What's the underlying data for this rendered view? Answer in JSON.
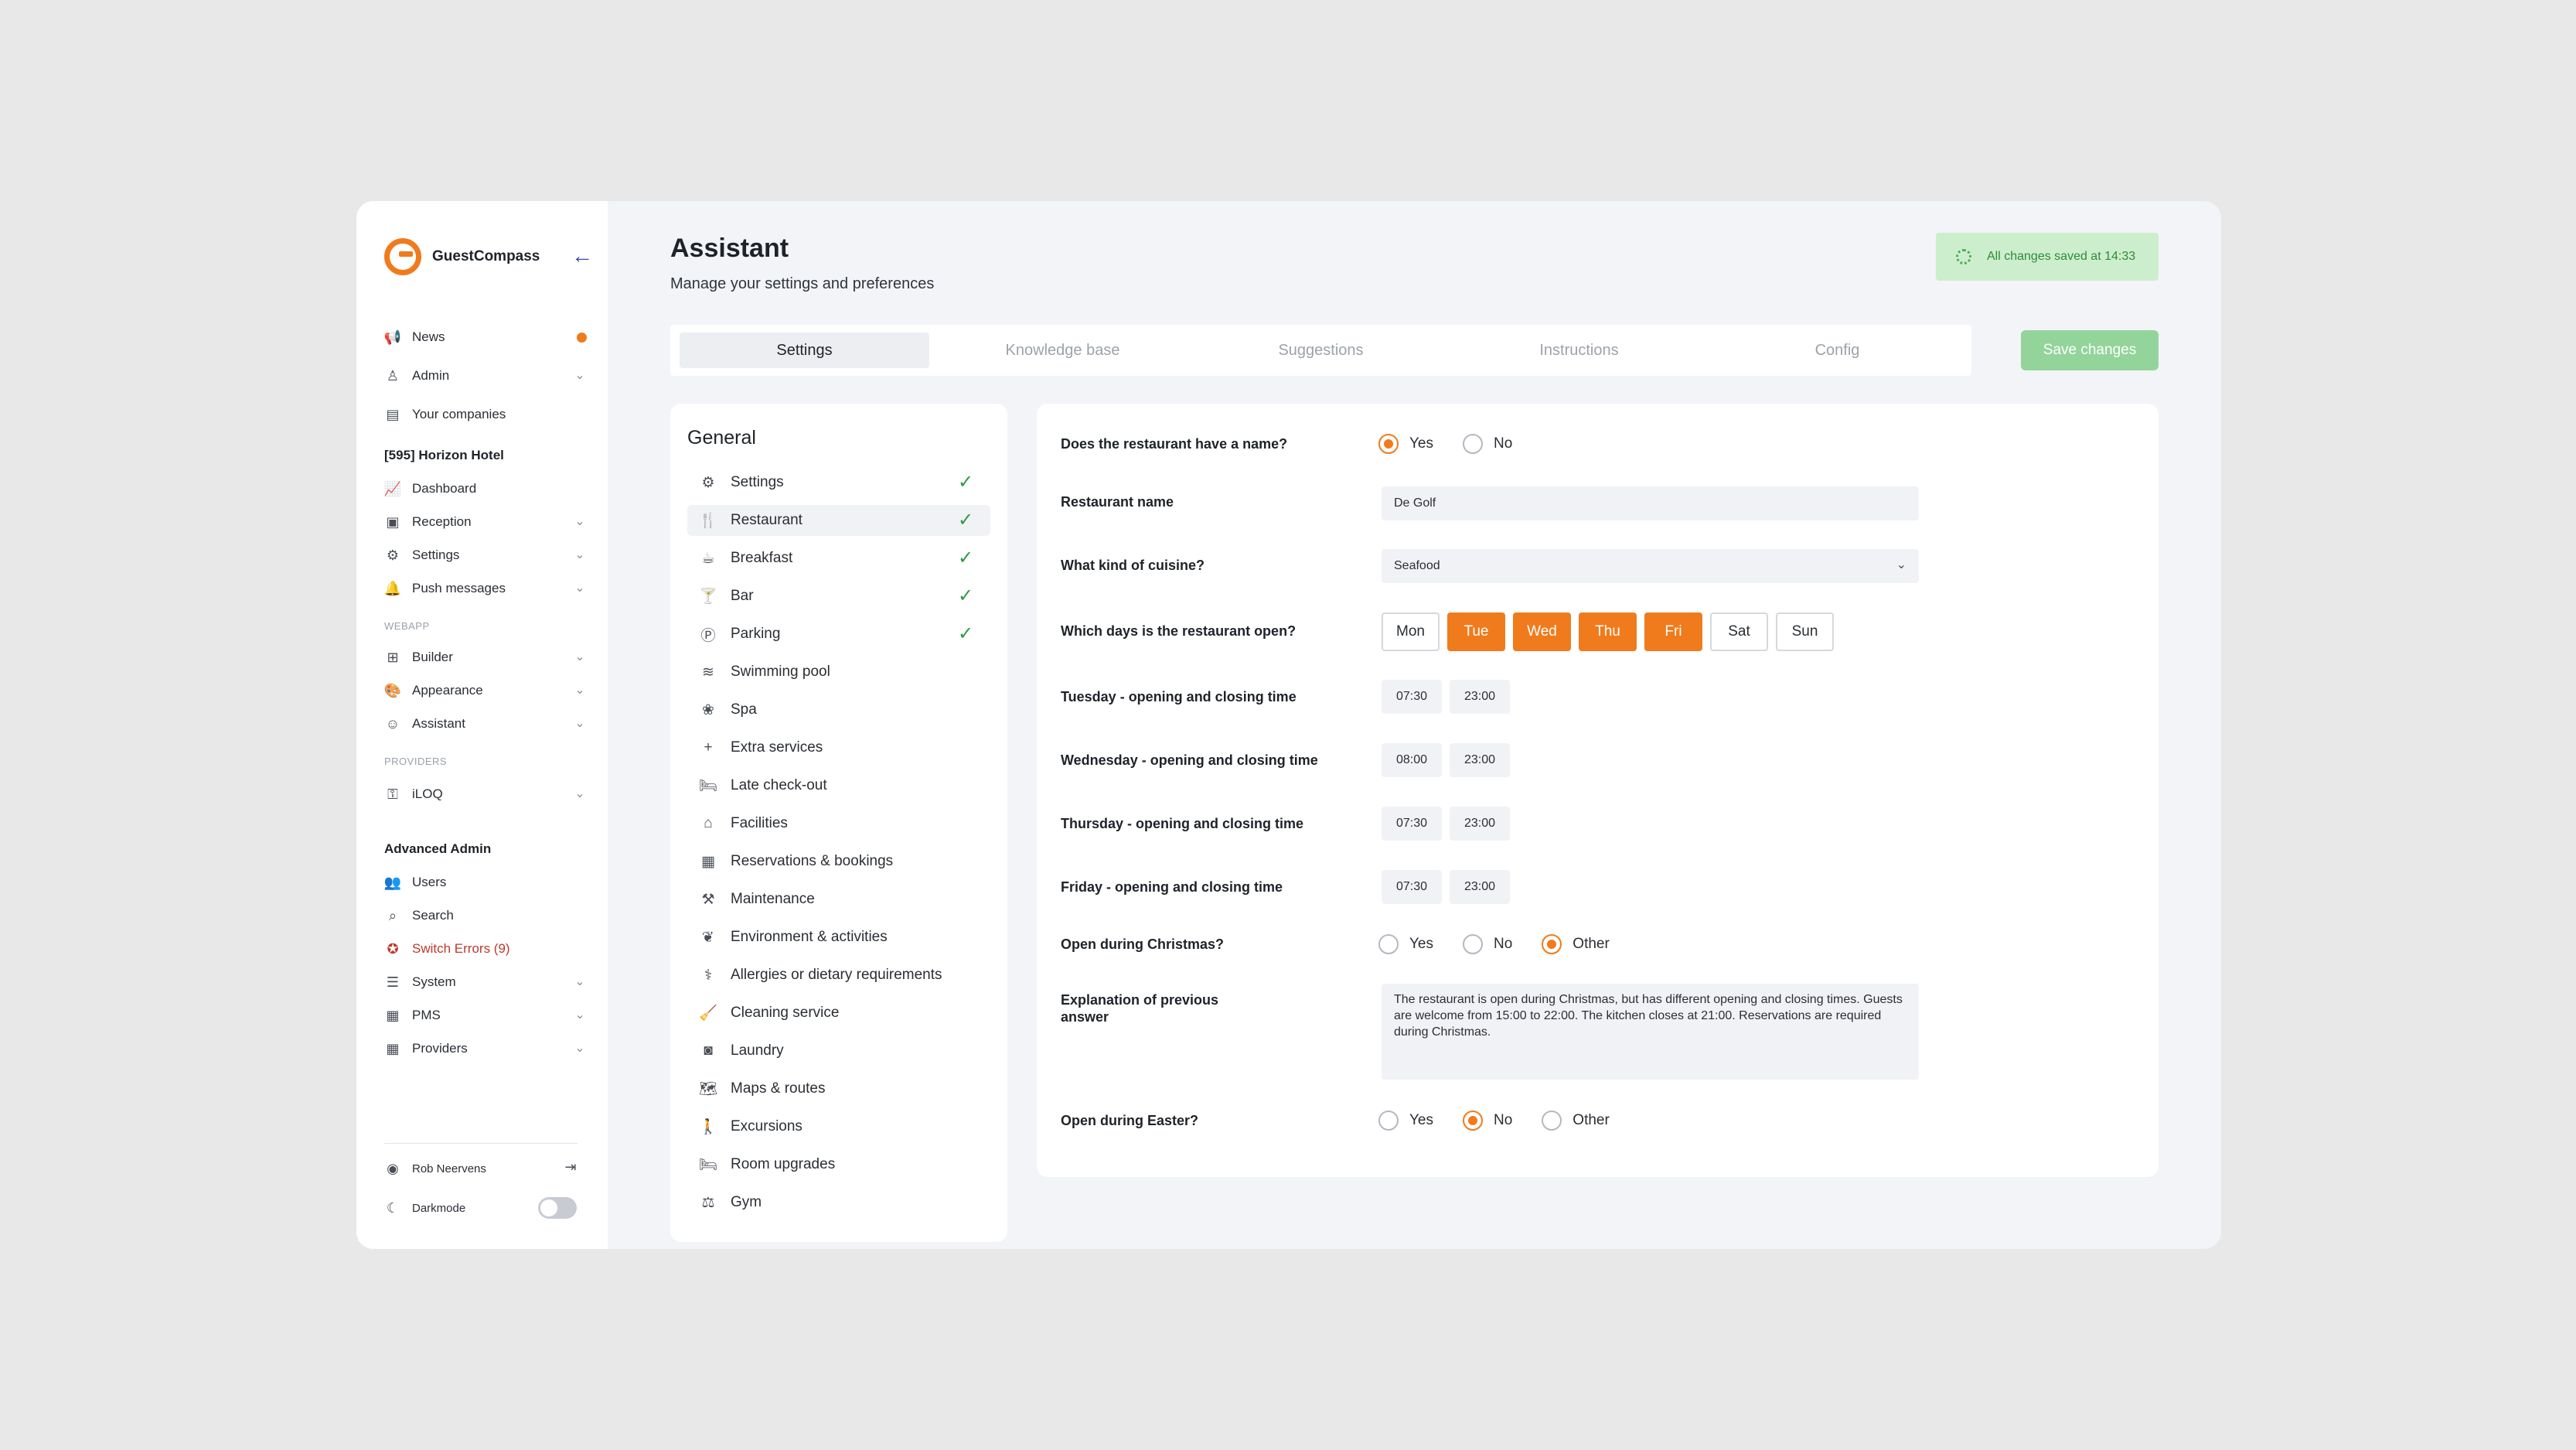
{
  "app": {
    "brand": "GuestCompass"
  },
  "sidebar": {
    "top_items": [
      {
        "label": "News",
        "icon": "megaphone-icon"
      },
      {
        "label": "Admin",
        "icon": "user-icon"
      },
      {
        "label": "Your companies",
        "icon": "building-icon"
      }
    ],
    "hotel_title": "[595] Horizon Hotel",
    "hotel_items": [
      {
        "label": "Dashboard",
        "icon": "chart-icon"
      },
      {
        "label": "Reception",
        "icon": "reception-icon"
      },
      {
        "label": "Settings",
        "icon": "gear-icon"
      },
      {
        "label": "Push messages",
        "icon": "bell-icon"
      }
    ],
    "webapp_label": "WEBAPP",
    "webapp_items": [
      {
        "label": "Builder",
        "icon": "builder-icon"
      },
      {
        "label": "Appearance",
        "icon": "palette-icon"
      },
      {
        "label": "Assistant",
        "icon": "bot-icon"
      }
    ],
    "providers_label": "PROVIDERS",
    "provider_items": [
      {
        "label": "iLOQ",
        "icon": "key-icon"
      }
    ],
    "advanced_title": "Advanced Admin",
    "advanced_items": [
      {
        "label": "Users",
        "icon": "users-icon"
      },
      {
        "label": "Search",
        "icon": "search-icon"
      },
      {
        "label": "Switch Errors (9)",
        "icon": "bug-icon"
      },
      {
        "label": "System",
        "icon": "database-icon"
      },
      {
        "label": "PMS",
        "icon": "calendar-icon"
      },
      {
        "label": "Providers",
        "icon": "calendar-icon"
      }
    ],
    "user_name": "Rob Neervens",
    "darkmode_label": "Darkmode",
    "darkmode_on": false
  },
  "header": {
    "title": "Assistant",
    "subtitle": "Manage your settings and preferences",
    "saved_status": "All changes saved at 14:33",
    "save_button": "Save changes"
  },
  "tabs": [
    "Settings",
    "Knowledge base",
    "Suggestions",
    "Instructions",
    "Config"
  ],
  "general": {
    "title": "General",
    "items": [
      {
        "label": "Settings",
        "icon": "gear-icon",
        "done": true
      },
      {
        "label": "Restaurant",
        "icon": "utensils-icon",
        "done": true
      },
      {
        "label": "Breakfast",
        "icon": "coffee-icon",
        "done": true
      },
      {
        "label": "Bar",
        "icon": "cocktail-icon",
        "done": true
      },
      {
        "label": "Parking",
        "icon": "parking-icon",
        "done": true
      },
      {
        "label": "Swimming pool",
        "icon": "pool-icon",
        "done": false
      },
      {
        "label": "Spa",
        "icon": "lotus-icon",
        "done": false
      },
      {
        "label": "Extra services",
        "icon": "plus-icon",
        "done": false
      },
      {
        "label": "Late check-out",
        "icon": "bed-icon",
        "done": false
      },
      {
        "label": "Facilities",
        "icon": "facilities-icon",
        "done": false
      },
      {
        "label": "Reservations & bookings",
        "icon": "calendar-icon",
        "done": false
      },
      {
        "label": "Maintenance",
        "icon": "hammer-icon",
        "done": false
      },
      {
        "label": "Environment & activities",
        "icon": "leaf-icon",
        "done": false
      },
      {
        "label": "Allergies or dietary requirements",
        "icon": "allergy-icon",
        "done": false
      },
      {
        "label": "Cleaning service",
        "icon": "broom-icon",
        "done": false
      },
      {
        "label": "Laundry",
        "icon": "washer-icon",
        "done": false
      },
      {
        "label": "Maps & routes",
        "icon": "map-icon",
        "done": false
      },
      {
        "label": "Excursions",
        "icon": "hiking-icon",
        "done": false
      },
      {
        "label": "Room upgrades",
        "icon": "bed-icon",
        "done": false
      },
      {
        "label": "Gym",
        "icon": "dumbbell-icon",
        "done": false
      }
    ]
  },
  "form": {
    "q_name": "Does the restaurant have a name?",
    "opt_yes": "Yes",
    "opt_no": "No",
    "opt_other": "Other",
    "q_restaurant_name": "Restaurant name",
    "restaurant_name_value": "De Golf",
    "q_cuisine": "What kind of cuisine?",
    "cuisine_value": "Seafood",
    "q_days": "Which days is the restaurant open?",
    "days": [
      {
        "label": "Mon",
        "open": false
      },
      {
        "label": "Tue",
        "open": true
      },
      {
        "label": "Wed",
        "open": true
      },
      {
        "label": "Thu",
        "open": true
      },
      {
        "label": "Fri",
        "open": true
      },
      {
        "label": "Sat",
        "open": false
      },
      {
        "label": "Sun",
        "open": false
      }
    ],
    "hours": [
      {
        "label": "Tuesday - opening and closing time",
        "open": "07:30",
        "close": "23:00"
      },
      {
        "label": "Wednesday - opening and closing time",
        "open": "08:00",
        "close": "23:00"
      },
      {
        "label": "Thursday - opening and closing time",
        "open": "07:30",
        "close": "23:00"
      },
      {
        "label": "Friday - opening and closing time",
        "open": "07:30",
        "close": "23:00"
      }
    ],
    "q_christmas": "Open during Christmas?",
    "christmas_selected": "Other",
    "q_explanation": "Explanation of previous answer",
    "explanation_value": "The restaurant is open during Christmas, but has different opening and closing times. Guests are welcome from 15:00 to 22:00. The kitchen closes at 21:00. Reservations are required during Christmas.",
    "q_easter": "Open during Easter?",
    "easter_selected": "No"
  },
  "colors": {
    "accent": "#f07b1d",
    "success": "#2f9a45",
    "saved_bg": "#cdeecd"
  }
}
